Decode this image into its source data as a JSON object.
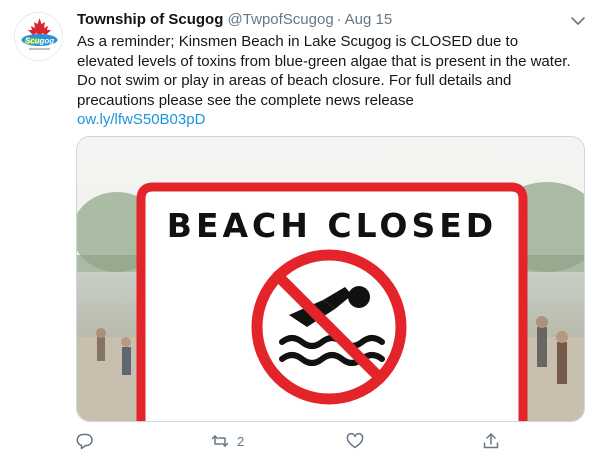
{
  "tweet": {
    "display_name": "Township of Scugog",
    "handle": "@TwpofScugog",
    "separator": "·",
    "date": "Aug 15",
    "text": "As a reminder; Kinsmen Beach in Lake Scugog is CLOSED due to elevated levels of toxins from blue-green algae that is present in the water. Do not swim or play in areas of beach closure. For full details and precautions please see the complete news release",
    "link": "ow.ly/lfwS50B03pD"
  },
  "avatar": {
    "logo_text": "Scugog",
    "brand_color": "#d7282f"
  },
  "media": {
    "sign_title": "BEACH CLOSED",
    "sign_color": "#e3242b",
    "icon": "no-swimming-icon"
  },
  "actions": {
    "reply_icon": "reply-icon",
    "retweet_icon": "retweet-icon",
    "retweet_count": "2",
    "like_icon": "heart-icon",
    "share_icon": "share-icon"
  },
  "colors": {
    "link": "#1b95e0",
    "secondary_text": "#657786"
  }
}
